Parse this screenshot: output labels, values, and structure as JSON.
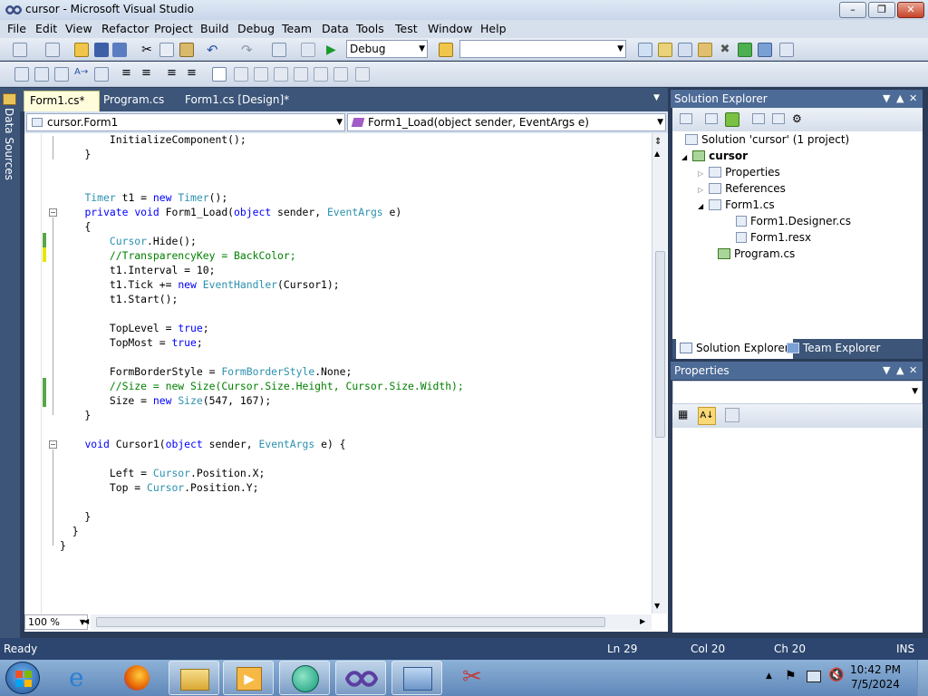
{
  "window": {
    "title": "cursor - Microsoft Visual Studio"
  },
  "menu": [
    "File",
    "Edit",
    "View",
    "Refactor",
    "Project",
    "Build",
    "Debug",
    "Team",
    "Data",
    "Tools",
    "Test",
    "Window",
    "Help"
  ],
  "toolbar": {
    "config": "Debug",
    "platform": ""
  },
  "side_strip": {
    "label": "Data Sources"
  },
  "tabs": [
    {
      "label": "Form1.cs*",
      "active": true
    },
    {
      "label": "Program.cs",
      "active": false
    },
    {
      "label": "Form1.cs [Design]*",
      "active": false
    }
  ],
  "nav": {
    "class_combo": "cursor.Form1",
    "member_combo": "Form1_Load(object sender, EventArgs e)"
  },
  "code": [
    [
      [
        "        InitializeComponent();",
        ""
      ]
    ],
    [
      [
        "    }",
        ""
      ]
    ],
    [
      [
        "",
        ""
      ]
    ],
    [
      [
        "",
        ""
      ]
    ],
    [
      [
        "    ",
        ""
      ],
      [
        "Timer",
        "ty"
      ],
      [
        " t1 = ",
        ""
      ],
      [
        "new",
        "kw"
      ],
      [
        " ",
        ""
      ],
      [
        "Timer",
        "ty"
      ],
      [
        "();",
        ""
      ]
    ],
    [
      [
        "    ",
        ""
      ],
      [
        "private",
        "kw"
      ],
      [
        " ",
        ""
      ],
      [
        "void",
        "kw"
      ],
      [
        " Form1_Load(",
        ""
      ],
      [
        "object",
        "kw"
      ],
      [
        " sender, ",
        ""
      ],
      [
        "EventArgs",
        "ty"
      ],
      [
        " e)",
        ""
      ]
    ],
    [
      [
        "    {",
        ""
      ]
    ],
    [
      [
        "        ",
        ""
      ],
      [
        "Cursor",
        "ty"
      ],
      [
        ".Hide();",
        ""
      ]
    ],
    [
      [
        "        ",
        ""
      ],
      [
        "//TransparencyKey = BackColor;",
        "cm"
      ]
    ],
    [
      [
        "        t1.Interval = 10;",
        ""
      ]
    ],
    [
      [
        "        t1.Tick += ",
        ""
      ],
      [
        "new",
        "kw"
      ],
      [
        " ",
        ""
      ],
      [
        "EventHandler",
        "ty"
      ],
      [
        "(Cursor1);",
        ""
      ]
    ],
    [
      [
        "        t1.Start();",
        ""
      ]
    ],
    [
      [
        "",
        ""
      ]
    ],
    [
      [
        "        TopLevel = ",
        ""
      ],
      [
        "true",
        "kw"
      ],
      [
        ";",
        ""
      ]
    ],
    [
      [
        "        TopMost = ",
        ""
      ],
      [
        "true",
        "kw"
      ],
      [
        ";",
        ""
      ]
    ],
    [
      [
        "",
        ""
      ]
    ],
    [
      [
        "        FormBorderStyle = ",
        ""
      ],
      [
        "FormBorderStyle",
        "ty"
      ],
      [
        ".None;",
        ""
      ]
    ],
    [
      [
        "        ",
        ""
      ],
      [
        "//Size = new Size(Cursor.Size.Height, Cursor.Size.Width);",
        "cm"
      ]
    ],
    [
      [
        "        Size = ",
        ""
      ],
      [
        "new",
        "kw"
      ],
      [
        " ",
        ""
      ],
      [
        "Size",
        "ty"
      ],
      [
        "(547, 167);",
        ""
      ]
    ],
    [
      [
        "    }",
        ""
      ]
    ],
    [
      [
        "",
        ""
      ]
    ],
    [
      [
        "    ",
        ""
      ],
      [
        "void",
        "kw"
      ],
      [
        " Cursor1(",
        ""
      ],
      [
        "object",
        "kw"
      ],
      [
        " sender, ",
        ""
      ],
      [
        "EventArgs",
        "ty"
      ],
      [
        " e) {",
        ""
      ]
    ],
    [
      [
        "",
        ""
      ]
    ],
    [
      [
        "        Left = ",
        ""
      ],
      [
        "Cursor",
        "ty"
      ],
      [
        ".Position.X;",
        ""
      ]
    ],
    [
      [
        "        Top = ",
        ""
      ],
      [
        "Cursor",
        "ty"
      ],
      [
        ".Position.Y;",
        ""
      ]
    ],
    [
      [
        "",
        ""
      ]
    ],
    [
      [
        "    }",
        ""
      ]
    ],
    [
      [
        "  }",
        ""
      ]
    ],
    [
      [
        "}",
        ""
      ]
    ]
  ],
  "editor": {
    "zoom": "100 %"
  },
  "solution_explorer": {
    "title": "Solution Explorer",
    "tree": [
      {
        "label": "Solution 'cursor' (1 project)",
        "bold": false
      },
      {
        "label": "cursor",
        "bold": true
      },
      {
        "label": "Properties",
        "bold": false
      },
      {
        "label": "References",
        "bold": false
      },
      {
        "label": "Form1.cs",
        "bold": false
      },
      {
        "label": "Form1.Designer.cs",
        "bold": false
      },
      {
        "label": "Form1.resx",
        "bold": false
      },
      {
        "label": "Program.cs",
        "bold": false
      }
    ],
    "tabs": [
      "Solution Explorer",
      "Team Explorer"
    ]
  },
  "properties": {
    "title": "Properties"
  },
  "status": {
    "state": "Ready",
    "ln": "Ln 29",
    "col": "Col 20",
    "ch": "Ch 20",
    "mode": "INS"
  },
  "taskbar": {
    "time": "10:42 PM",
    "date": "7/5/2024"
  },
  "colors": {
    "keyword": "#0000ff",
    "type": "#2b91af",
    "comment": "#008000",
    "accent": "#3c5579"
  }
}
